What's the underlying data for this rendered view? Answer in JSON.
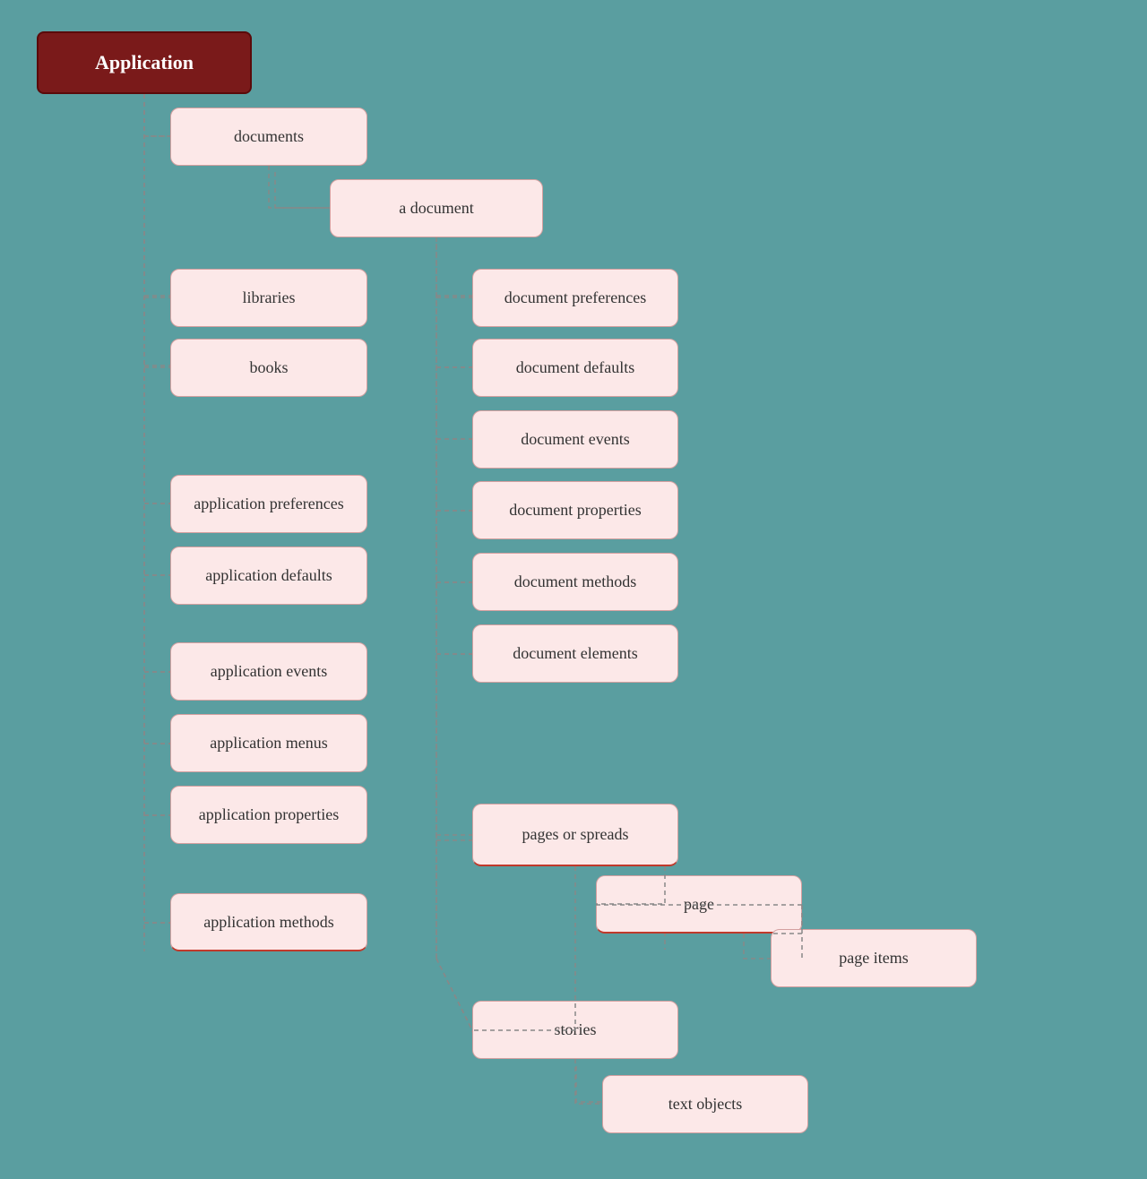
{
  "title": "Application",
  "nodes": {
    "root": {
      "label": "Application"
    },
    "documents": {
      "label": "documents"
    },
    "a_document": {
      "label": "a document"
    },
    "libraries": {
      "label": "libraries"
    },
    "books": {
      "label": "books"
    },
    "application_preferences": {
      "label": "application preferences"
    },
    "application_defaults": {
      "label": "application defaults"
    },
    "application_events": {
      "label": "application events"
    },
    "application_menus": {
      "label": "application menus"
    },
    "application_properties": {
      "label": "application properties"
    },
    "application_methods": {
      "label": "application methods"
    },
    "document_preferences": {
      "label": "document preferences"
    },
    "document_defaults": {
      "label": "document defaults"
    },
    "document_events": {
      "label": "document events"
    },
    "document_properties": {
      "label": "document properties"
    },
    "document_methods": {
      "label": "document methods"
    },
    "document_elements": {
      "label": "document elements"
    },
    "pages_or_spreads": {
      "label": "pages or spreads"
    },
    "page": {
      "label": "page"
    },
    "stories": {
      "label": "stories"
    },
    "page_items": {
      "label": "page items"
    },
    "text_objects": {
      "label": "text objects"
    }
  }
}
